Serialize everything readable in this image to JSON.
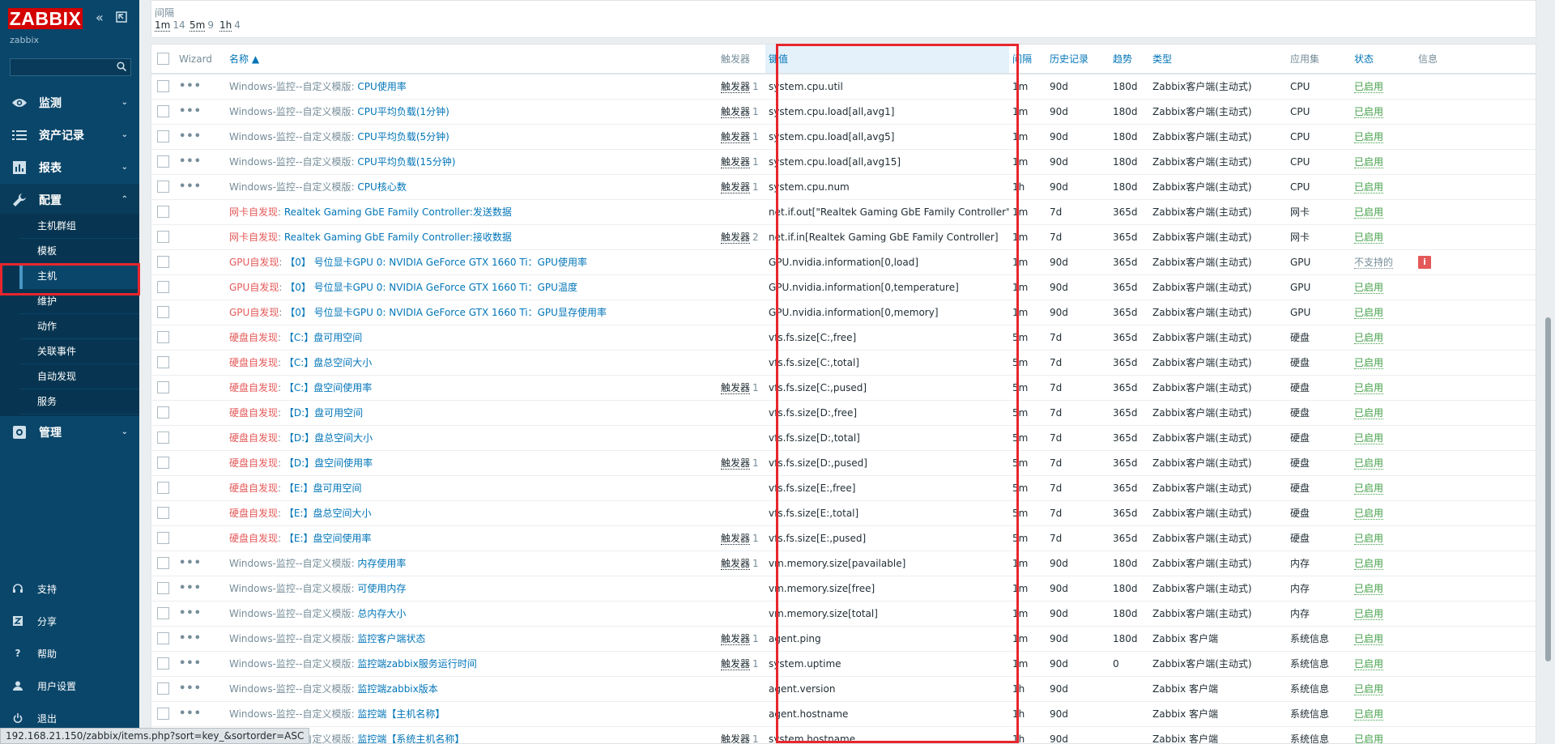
{
  "app": {
    "logo": "ZABBIX",
    "server_name": "zabbix"
  },
  "sidebar": {
    "nav": [
      {
        "label": "监测",
        "icon": "eye-icon"
      },
      {
        "label": "资产记录",
        "icon": "list-icon"
      },
      {
        "label": "报表",
        "icon": "bar-chart-icon"
      },
      {
        "label": "配置",
        "icon": "wrench-icon"
      },
      {
        "label": "管理",
        "icon": "gear-icon"
      }
    ],
    "config_sub": [
      "主机群组",
      "模板",
      "主机",
      "维护",
      "动作",
      "关联事件",
      "自动发现",
      "服务"
    ],
    "selected_sub": "主机",
    "bottom": [
      {
        "label": "支持",
        "icon": "headset-icon"
      },
      {
        "label": "分享",
        "icon": "share-icon"
      },
      {
        "label": "帮助",
        "icon": "help-icon"
      },
      {
        "label": "用户设置",
        "icon": "user-icon"
      },
      {
        "label": "退出",
        "icon": "power-icon"
      }
    ]
  },
  "filter": {
    "label": "间隔",
    "options": [
      {
        "value": "1m",
        "count": "14"
      },
      {
        "value": "5m",
        "count": "9"
      },
      {
        "value": "1h",
        "count": "4"
      }
    ]
  },
  "table": {
    "headers": {
      "wizard": "Wizard",
      "name": "名称 ▲",
      "triggers": "触发器",
      "key": "键值",
      "interval": "间隔",
      "history": "历史记录",
      "trends": "趋势",
      "type": "类型",
      "app": "应用集",
      "status": "状态",
      "info": "信息"
    },
    "rows": [
      {
        "wizard": true,
        "prefix": "Windows-监控--自定义模版",
        "prefix_style": "gray",
        "name": "CPU使用率",
        "triggers": "1",
        "key": "system.cpu.util",
        "interval": "1m",
        "history": "90d",
        "trends": "180d",
        "type": "Zabbix客户端(主动式)",
        "app": "CPU",
        "status": "已启用",
        "info": ""
      },
      {
        "wizard": true,
        "prefix": "Windows-监控--自定义模版",
        "prefix_style": "gray",
        "name": "CPU平均负载(1分钟)",
        "triggers": "1",
        "key": "system.cpu.load[all,avg1]",
        "interval": "1m",
        "history": "90d",
        "trends": "180d",
        "type": "Zabbix客户端(主动式)",
        "app": "CPU",
        "status": "已启用",
        "info": ""
      },
      {
        "wizard": true,
        "prefix": "Windows-监控--自定义模版",
        "prefix_style": "gray",
        "name": "CPU平均负载(5分钟)",
        "triggers": "1",
        "key": "system.cpu.load[all,avg5]",
        "interval": "1m",
        "history": "90d",
        "trends": "180d",
        "type": "Zabbix客户端(主动式)",
        "app": "CPU",
        "status": "已启用",
        "info": ""
      },
      {
        "wizard": true,
        "prefix": "Windows-监控--自定义模版",
        "prefix_style": "gray",
        "name": "CPU平均负载(15分钟)",
        "triggers": "1",
        "key": "system.cpu.load[all,avg15]",
        "interval": "1m",
        "history": "90d",
        "trends": "180d",
        "type": "Zabbix客户端(主动式)",
        "app": "CPU",
        "status": "已启用",
        "info": ""
      },
      {
        "wizard": true,
        "prefix": "Windows-监控--自定义模版",
        "prefix_style": "gray",
        "name": "CPU核心数",
        "triggers": "1",
        "key": "system.cpu.num",
        "interval": "1h",
        "history": "90d",
        "trends": "180d",
        "type": "Zabbix客户端(主动式)",
        "app": "CPU",
        "status": "已启用",
        "info": ""
      },
      {
        "wizard": false,
        "prefix": "网卡自发现",
        "prefix_style": "orange",
        "name": "Realtek Gaming GbE Family Controller:发送数据",
        "triggers": "",
        "key": "net.if.out[\"Realtek Gaming GbE Family Controller\"]",
        "interval": "1m",
        "history": "7d",
        "trends": "365d",
        "type": "Zabbix客户端(主动式)",
        "app": "网卡",
        "status": "已启用",
        "info": ""
      },
      {
        "wizard": false,
        "prefix": "网卡自发现",
        "prefix_style": "orange",
        "name": "Realtek Gaming GbE Family Controller:接收数据",
        "triggers": "2",
        "key": "net.if.in[Realtek Gaming GbE Family Controller]",
        "interval": "1m",
        "history": "7d",
        "trends": "365d",
        "type": "Zabbix客户端(主动式)",
        "app": "网卡",
        "status": "已启用",
        "info": ""
      },
      {
        "wizard": false,
        "prefix": "GPU自发现",
        "prefix_style": "orange",
        "name": "【0】 号位显卡GPU 0: NVIDIA GeForce GTX 1660 Ti：GPU使用率",
        "triggers": "",
        "key": "GPU.nvidia.information[0,load]",
        "interval": "1m",
        "history": "90d",
        "trends": "365d",
        "type": "Zabbix客户端(主动式)",
        "app": "GPU",
        "status": "不支持的",
        "info": "i"
      },
      {
        "wizard": false,
        "prefix": "GPU自发现",
        "prefix_style": "orange",
        "name": "【0】 号位显卡GPU 0: NVIDIA GeForce GTX 1660 Ti：GPU温度",
        "triggers": "",
        "key": "GPU.nvidia.information[0,temperature]",
        "interval": "1m",
        "history": "90d",
        "trends": "365d",
        "type": "Zabbix客户端(主动式)",
        "app": "GPU",
        "status": "已启用",
        "info": ""
      },
      {
        "wizard": false,
        "prefix": "GPU自发现",
        "prefix_style": "orange",
        "name": "【0】 号位显卡GPU 0: NVIDIA GeForce GTX 1660 Ti：GPU显存使用率",
        "triggers": "",
        "key": "GPU.nvidia.information[0,memory]",
        "interval": "1m",
        "history": "90d",
        "trends": "365d",
        "type": "Zabbix客户端(主动式)",
        "app": "GPU",
        "status": "已启用",
        "info": ""
      },
      {
        "wizard": false,
        "prefix": "硬盘自发现",
        "prefix_style": "orange",
        "name": "【C:】盘可用空间",
        "triggers": "",
        "key": "vfs.fs.size[C:,free]",
        "interval": "5m",
        "history": "7d",
        "trends": "365d",
        "type": "Zabbix客户端(主动式)",
        "app": "硬盘",
        "status": "已启用",
        "info": ""
      },
      {
        "wizard": false,
        "prefix": "硬盘自发现",
        "prefix_style": "orange",
        "name": "【C:】盘总空间大小",
        "triggers": "",
        "key": "vfs.fs.size[C:,total]",
        "interval": "5m",
        "history": "7d",
        "trends": "365d",
        "type": "Zabbix客户端(主动式)",
        "app": "硬盘",
        "status": "已启用",
        "info": ""
      },
      {
        "wizard": false,
        "prefix": "硬盘自发现",
        "prefix_style": "orange",
        "name": "【C:】盘空间使用率",
        "triggers": "1",
        "key": "vfs.fs.size[C:,pused]",
        "interval": "5m",
        "history": "7d",
        "trends": "365d",
        "type": "Zabbix客户端(主动式)",
        "app": "硬盘",
        "status": "已启用",
        "info": ""
      },
      {
        "wizard": false,
        "prefix": "硬盘自发现",
        "prefix_style": "orange",
        "name": "【D:】盘可用空间",
        "triggers": "",
        "key": "vfs.fs.size[D:,free]",
        "interval": "5m",
        "history": "7d",
        "trends": "365d",
        "type": "Zabbix客户端(主动式)",
        "app": "硬盘",
        "status": "已启用",
        "info": ""
      },
      {
        "wizard": false,
        "prefix": "硬盘自发现",
        "prefix_style": "orange",
        "name": "【D:】盘总空间大小",
        "triggers": "",
        "key": "vfs.fs.size[D:,total]",
        "interval": "5m",
        "history": "7d",
        "trends": "365d",
        "type": "Zabbix客户端(主动式)",
        "app": "硬盘",
        "status": "已启用",
        "info": ""
      },
      {
        "wizard": false,
        "prefix": "硬盘自发现",
        "prefix_style": "orange",
        "name": "【D:】盘空间使用率",
        "triggers": "1",
        "key": "vfs.fs.size[D:,pused]",
        "interval": "5m",
        "history": "7d",
        "trends": "365d",
        "type": "Zabbix客户端(主动式)",
        "app": "硬盘",
        "status": "已启用",
        "info": ""
      },
      {
        "wizard": false,
        "prefix": "硬盘自发现",
        "prefix_style": "orange",
        "name": "【E:】盘可用空间",
        "triggers": "",
        "key": "vfs.fs.size[E:,free]",
        "interval": "5m",
        "history": "7d",
        "trends": "365d",
        "type": "Zabbix客户端(主动式)",
        "app": "硬盘",
        "status": "已启用",
        "info": ""
      },
      {
        "wizard": false,
        "prefix": "硬盘自发现",
        "prefix_style": "orange",
        "name": "【E:】盘总空间大小",
        "triggers": "",
        "key": "vfs.fs.size[E:,total]",
        "interval": "5m",
        "history": "7d",
        "trends": "365d",
        "type": "Zabbix客户端(主动式)",
        "app": "硬盘",
        "status": "已启用",
        "info": ""
      },
      {
        "wizard": false,
        "prefix": "硬盘自发现",
        "prefix_style": "orange",
        "name": "【E:】盘空间使用率",
        "triggers": "1",
        "key": "vfs.fs.size[E:,pused]",
        "interval": "5m",
        "history": "7d",
        "trends": "365d",
        "type": "Zabbix客户端(主动式)",
        "app": "硬盘",
        "status": "已启用",
        "info": ""
      },
      {
        "wizard": true,
        "prefix": "Windows-监控--自定义模版",
        "prefix_style": "gray",
        "name": "内存使用率",
        "triggers": "1",
        "key": "vm.memory.size[pavailable]",
        "interval": "1m",
        "history": "90d",
        "trends": "180d",
        "type": "Zabbix客户端(主动式)",
        "app": "内存",
        "status": "已启用",
        "info": ""
      },
      {
        "wizard": true,
        "prefix": "Windows-监控--自定义模版",
        "prefix_style": "gray",
        "name": "可使用内存",
        "triggers": "",
        "key": "vm.memory.size[free]",
        "interval": "1m",
        "history": "90d",
        "trends": "180d",
        "type": "Zabbix客户端(主动式)",
        "app": "内存",
        "status": "已启用",
        "info": ""
      },
      {
        "wizard": true,
        "prefix": "Windows-监控--自定义模版",
        "prefix_style": "gray",
        "name": "总内存大小",
        "triggers": "",
        "key": "vm.memory.size[total]",
        "interval": "1m",
        "history": "90d",
        "trends": "180d",
        "type": "Zabbix客户端(主动式)",
        "app": "内存",
        "status": "已启用",
        "info": ""
      },
      {
        "wizard": true,
        "prefix": "Windows-监控--自定义模版",
        "prefix_style": "gray",
        "name": "监控客户端状态",
        "triggers": "1",
        "key": "agent.ping",
        "interval": "1m",
        "history": "90d",
        "trends": "180d",
        "type": "Zabbix 客户端",
        "app": "系统信息",
        "status": "已启用",
        "info": ""
      },
      {
        "wizard": true,
        "prefix": "Windows-监控--自定义模版",
        "prefix_style": "gray",
        "name": "监控端zabbix服务运行时间",
        "triggers": "1",
        "key": "system.uptime",
        "interval": "1m",
        "history": "90d",
        "trends": "0",
        "type": "Zabbix客户端(主动式)",
        "app": "系统信息",
        "status": "已启用",
        "info": ""
      },
      {
        "wizard": true,
        "prefix": "Windows-监控--自定义模版",
        "prefix_style": "gray",
        "name": "监控端zabbix版本",
        "triggers": "",
        "key": "agent.version",
        "interval": "1h",
        "history": "90d",
        "trends": "",
        "type": "Zabbix 客户端",
        "app": "系统信息",
        "status": "已启用",
        "info": ""
      },
      {
        "wizard": true,
        "prefix": "Windows-监控--自定义模版",
        "prefix_style": "gray",
        "name": "监控端【主机名称】",
        "triggers": "",
        "key": "agent.hostname",
        "interval": "1h",
        "history": "90d",
        "trends": "",
        "type": "Zabbix 客户端",
        "app": "系统信息",
        "status": "已启用",
        "info": ""
      },
      {
        "wizard": true,
        "prefix": "Windows-监控--自定义模版",
        "prefix_style": "gray",
        "name": "监控端【系统主机名称】",
        "triggers": "1",
        "key": "system.hostname",
        "interval": "1h",
        "history": "90d",
        "trends": "",
        "type": "Zabbix 客户端",
        "app": "系统信息",
        "status": "已启用",
        "info": ""
      }
    ],
    "trigger_label": "触发器"
  },
  "status_bar": "192.168.21.150/zabbix/items.php?sort=key_&sortorder=ASC",
  "colors": {
    "sidebar_bg": "#0a466a",
    "link": "#0275b8",
    "enabled": "#429e47",
    "discovery_prefix": "#e45959",
    "highlight": "#e8262d"
  }
}
